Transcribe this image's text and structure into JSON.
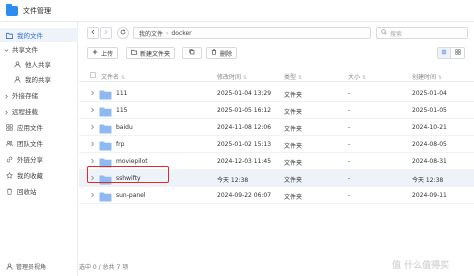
{
  "window": {
    "title": "文件管理"
  },
  "sidebar": {
    "items": [
      {
        "label": "我的文件",
        "icon": "folder-icon",
        "active": true
      },
      {
        "label": "共享文件",
        "icon": "chevron-down-icon",
        "head": true
      },
      {
        "label": "他人共享",
        "icon": "user-icon",
        "sub": true
      },
      {
        "label": "我的共享",
        "icon": "share-icon",
        "sub": true
      },
      {
        "label": "外接存储",
        "icon": "chevron-right-icon",
        "head": true
      },
      {
        "label": "远程挂载",
        "icon": "chevron-right-icon",
        "head": true
      },
      {
        "label": "应用文件",
        "icon": "grid-icon"
      },
      {
        "label": "团队文件",
        "icon": "team-icon"
      },
      {
        "label": "外链分享",
        "icon": "link-icon"
      },
      {
        "label": "我的收藏",
        "icon": "star-icon"
      },
      {
        "label": "回收站",
        "icon": "trash-icon"
      }
    ],
    "footer_label": "管理员视角"
  },
  "nav": {
    "path": [
      "我的文件",
      "docker"
    ],
    "search_placeholder": "搜索"
  },
  "toolbar": {
    "upload": "上传",
    "new_folder": "新建文件夹",
    "copy": "",
    "delete": "删除"
  },
  "table": {
    "columns": {
      "name": "文件名",
      "modified": "修改时间",
      "type": "类型",
      "size": "大小",
      "created": "创建时间"
    },
    "rows": [
      {
        "name": "111",
        "modified": "2025-01-04 13:29",
        "type": "文件夹",
        "size": "-",
        "created": "2025-01-04"
      },
      {
        "name": "115",
        "modified": "2025-01-05 16:12",
        "type": "文件夹",
        "size": "-",
        "created": "2025-01-05"
      },
      {
        "name": "baidu",
        "modified": "2024-11-08 12:06",
        "type": "文件夹",
        "size": "-",
        "created": "2024-10-21"
      },
      {
        "name": "frp",
        "modified": "2025-01-02 15:13",
        "type": "文件夹",
        "size": "-",
        "created": "2024-08-05"
      },
      {
        "name": "moviepilot",
        "modified": "2024-12-03 11:45",
        "type": "文件夹",
        "size": "-",
        "created": "2024-08-31"
      },
      {
        "name": "sshwifty",
        "modified": "今天 12:38",
        "type": "文件夹",
        "size": "-",
        "created": "今天 12:38"
      },
      {
        "name": "sun-panel",
        "modified": "2024-09-22 06:07",
        "type": "文件夹",
        "size": "-",
        "created": "2024-09-11"
      }
    ]
  },
  "status": {
    "text": "选中 0 / 总共 7 项"
  },
  "watermark": "值 什么值得买",
  "colors": {
    "accent": "#2f6cd8",
    "folder": "#8fb9f0",
    "highlight_border": "#e02a2a"
  }
}
